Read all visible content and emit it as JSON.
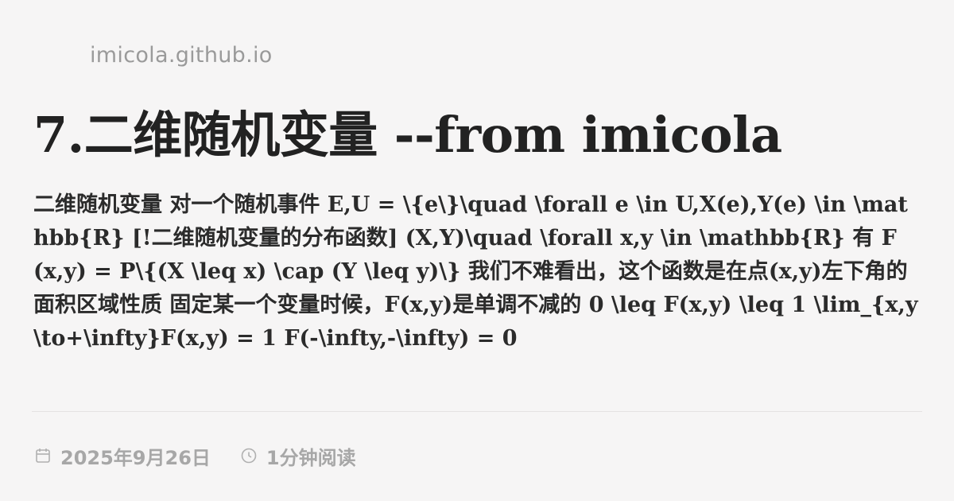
{
  "site": {
    "domain": "imicola.github.io"
  },
  "post": {
    "title": "7.二维随机变量 --from imicola",
    "excerpt": "二维随机变量 对一个随机事件 E,U = \\{e\\}\\quad \\forall e \\in U,X(e),Y(e) \\in \\mathbb{R} [!二维随机变量的分布函数] (X,Y)\\quad \\forall x,y \\in \\mathbb{R} 有 F(x,y) = P\\{(X \\leq x) \\cap (Y \\leq y)\\} 我们不难看出，这个函数是在点(x,y)左下角的面积区域性质 固定某一个变量时候，F(x,y)是单调不减的 0 \\leq F(x,y) \\leq 1 \\lim_{x,y\\to+\\infty}F(x,y) = 1 F(-\\infty,-\\infty) = 0",
    "date": "2025年9月26日",
    "reading_time": "1分钟阅读"
  },
  "icons": {
    "date": "calendar-icon",
    "reading_time": "clock-icon"
  },
  "colors": {
    "background": "#f6f5f5",
    "title": "#222222",
    "excerpt": "#2b2b2b",
    "muted": "#9a9a9a",
    "divider": "#e4e2e2"
  }
}
